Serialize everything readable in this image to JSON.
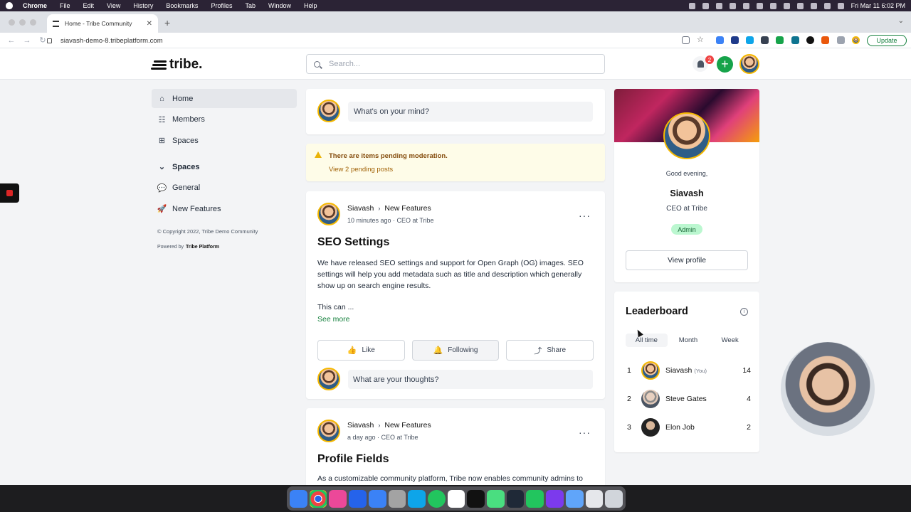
{
  "menubar": {
    "items": [
      "Chrome",
      "File",
      "Edit",
      "View",
      "History",
      "Bookmarks",
      "Profiles",
      "Tab",
      "Window",
      "Help"
    ],
    "clock": "Fri Mar 11  6:02 PM"
  },
  "browser": {
    "tab_title": "Home - Tribe Community",
    "url": "siavash-demo-8.tribeplatform.com",
    "update_label": "Update"
  },
  "header": {
    "logo_text": "tribe.",
    "search_placeholder": "Search...",
    "notification_count": "2",
    "create_label": "+"
  },
  "sidebar": {
    "items": [
      {
        "label": "Home",
        "icon": "home-icon"
      },
      {
        "label": "Members",
        "icon": "members-icon"
      },
      {
        "label": "Spaces",
        "icon": "grid-icon"
      }
    ],
    "spaces_heading": "Spaces",
    "spaces": [
      {
        "label": "General",
        "icon": "speech-bubble-icon"
      },
      {
        "label": "New Features",
        "icon": "rocket-icon"
      }
    ],
    "copyright": "© Copyright 2022, Tribe Demo Community",
    "powered_prefix": "Powered by",
    "powered_brand": "Tribe Platform"
  },
  "composer": {
    "placeholder": "What's on your mind?"
  },
  "moderation": {
    "title": "There are items pending moderation.",
    "link": "View 2 pending posts"
  },
  "posts": [
    {
      "author": "Siavash",
      "space": "New Features",
      "meta": "10 minutes ago · CEO at Tribe",
      "title": "SEO Settings",
      "body": "We have released SEO settings and support for Open Graph (OG) images. SEO settings will help you add metadata such as title and description which generally show up on search engine results.",
      "excerpt": "This can ...",
      "see_more": "See more",
      "like": "Like",
      "following": "Following",
      "share": "Share",
      "reply_placeholder": "What are your thoughts?"
    },
    {
      "author": "Siavash",
      "space": "New Features",
      "meta": "a day ago · CEO at Tribe",
      "title": "Profile Fields",
      "body": "As a customizable community platform, Tribe now enables community admins to"
    }
  ],
  "profile": {
    "greeting": "Good evening,",
    "name": "Siavash",
    "role": "CEO at Tribe",
    "badge": "Admin",
    "view_profile": "View profile"
  },
  "leaderboard": {
    "title": "Leaderboard",
    "tabs": [
      "All time",
      "Month",
      "Week"
    ],
    "rows": [
      {
        "rank": "1",
        "name": "Siavash",
        "you": "(You)",
        "points": "14"
      },
      {
        "rank": "2",
        "name": "Steve Gates",
        "you": "",
        "points": "4"
      },
      {
        "rank": "3",
        "name": "Elon Job",
        "you": "",
        "points": "2"
      }
    ]
  },
  "colors": {
    "accent": "#16a34a",
    "moderation_bg": "#fefce8",
    "notification": "#ef4444"
  }
}
